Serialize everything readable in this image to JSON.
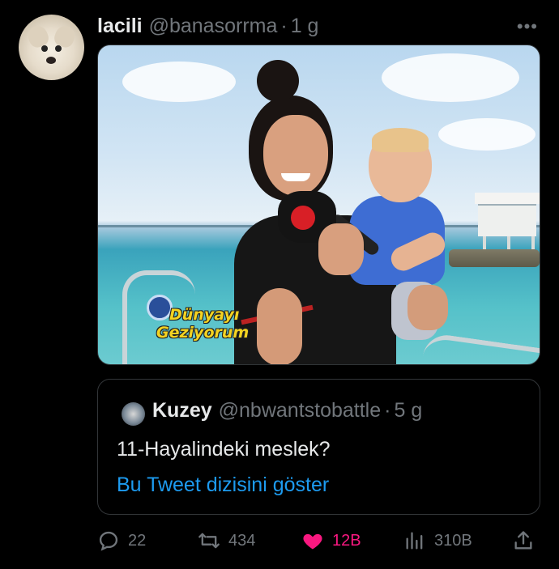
{
  "tweet": {
    "display_name": "lacili",
    "handle": "@banasorrma",
    "separator": "·",
    "time": "1 g",
    "more_label": "•••",
    "media": {
      "logo_line1": "Dünyayı",
      "logo_line2": "Geziyorum"
    }
  },
  "quoted_tweet": {
    "display_name": "Kuzey",
    "handle": "@nbwantstobattle",
    "separator": "·",
    "time": "5 g",
    "text": "11-Hayalindeki meslek?",
    "thread_link": "Bu Tweet dizisini göster"
  },
  "actions": {
    "reply_count": "22",
    "retweet_count": "434",
    "like_count": "12B",
    "view_count": "310B"
  },
  "colors": {
    "background": "#000000",
    "primary_text": "#e7e9ea",
    "secondary_text": "#71767b",
    "link": "#1d9bf0",
    "like_active": "#f91880",
    "border": "#2f3336"
  }
}
